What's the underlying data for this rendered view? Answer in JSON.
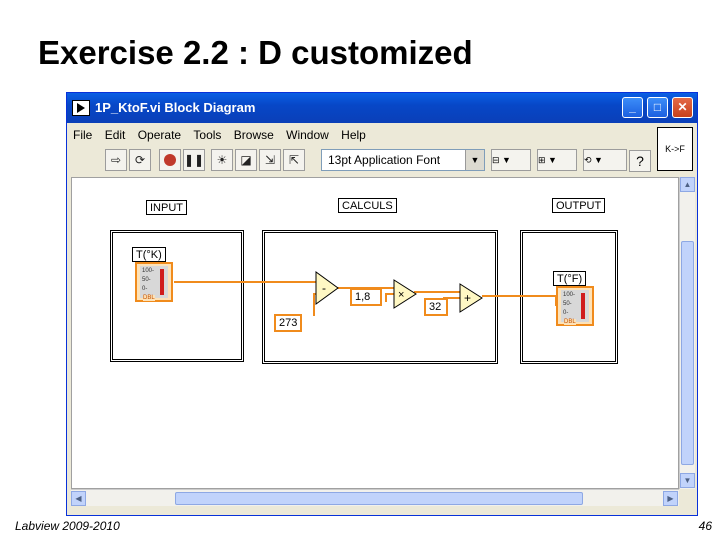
{
  "slide": {
    "title": "Exercise 2.2 : D customized",
    "footer_left": "Labview 2009-2010",
    "page_number": "46"
  },
  "window": {
    "title": "1P_KtoF.vi Block Diagram",
    "buttons": {
      "minimize": "_",
      "maximize": "□",
      "close": "✕"
    }
  },
  "menu": [
    "File",
    "Edit",
    "Operate",
    "Tools",
    "Browse",
    "Window",
    "Help"
  ],
  "toolbar": {
    "font_value": "13pt Application Font",
    "help_label": "?"
  },
  "connector_pane": {
    "label": "K->F"
  },
  "diagram": {
    "input_label": "INPUT",
    "calculs_label": "CALCULS",
    "output_label": "OUTPUT",
    "input_indicator": {
      "name": "T(°K)",
      "ticks": [
        "100-",
        "50-",
        "0-"
      ],
      "type": "DBL"
    },
    "output_indicator": {
      "name": "T(°F)",
      "ticks": [
        "100-",
        "50-",
        "0-"
      ],
      "type": "DBL"
    },
    "constants": {
      "c273": "273",
      "c18": "1,8",
      "c32": "32"
    },
    "operators": {
      "subtract": "-",
      "multiply": "×",
      "add": "+"
    }
  },
  "colors": {
    "wire": "#f08b1c",
    "titlebar": "#0a5fe4",
    "thermo_fill": "#d01c1c"
  }
}
